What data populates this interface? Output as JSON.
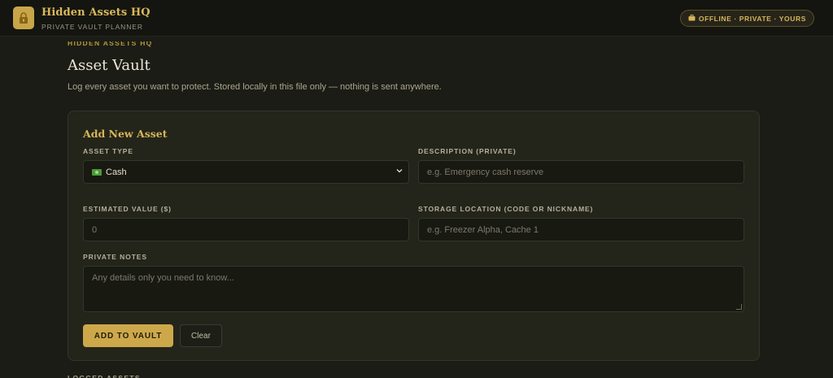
{
  "header": {
    "logo_icon": "lock-icon",
    "brand_title": "Hidden Assets HQ",
    "brand_subtitle": "PRIVATE VAULT PLANNER",
    "badge_icon": "briefcase-icon",
    "badge_text": "OFFLINE · PRIVATE · YOURS"
  },
  "page": {
    "eyebrow": "HIDDEN ASSETS HQ",
    "title": "Asset Vault",
    "description": "Log every asset you want to protect. Stored locally in this file only — nothing is sent anywhere."
  },
  "form": {
    "title": "Add New Asset",
    "asset_type": {
      "label": "ASSET TYPE",
      "icon": "money-icon",
      "selected": "Cash"
    },
    "description": {
      "label": "DESCRIPTION (PRIVATE)",
      "placeholder": "e.g. Emergency cash reserve"
    },
    "estimated_value": {
      "label": "ESTIMATED VALUE ($)",
      "placeholder": "0"
    },
    "storage_location": {
      "label": "STORAGE LOCATION (CODE OR NICKNAME)",
      "placeholder": "e.g. Freezer Alpha, Cache 1"
    },
    "notes": {
      "label": "PRIVATE NOTES",
      "placeholder": "Any details only you need to know..."
    },
    "add_button": "ADD TO VAULT",
    "clear_button": "Clear"
  },
  "logged_section": {
    "title": "LOGGED ASSETS"
  },
  "colors": {
    "accent": "#cda84b",
    "background": "#1b1c15",
    "card": "#24251a"
  }
}
